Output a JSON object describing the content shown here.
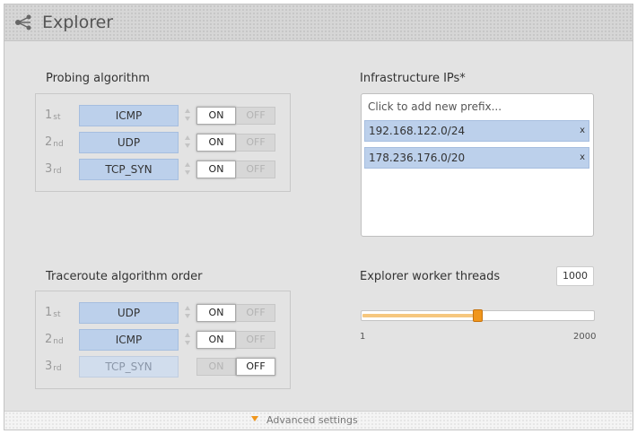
{
  "header": {
    "title": "Explorer",
    "icon": "share-icon"
  },
  "probing": {
    "title": "Probing algorithm",
    "rows": [
      {
        "ordinal": "1",
        "suffix": "st",
        "algo": "ICMP",
        "on": "ON",
        "off": "OFF",
        "state": "on"
      },
      {
        "ordinal": "2",
        "suffix": "nd",
        "algo": "UDP",
        "on": "ON",
        "off": "OFF",
        "state": "on"
      },
      {
        "ordinal": "3",
        "suffix": "rd",
        "algo": "TCP_SYN",
        "on": "ON",
        "off": "OFF",
        "state": "on"
      }
    ]
  },
  "traceroute": {
    "title": "Traceroute algorithm order",
    "rows": [
      {
        "ordinal": "1",
        "suffix": "st",
        "algo": "UDP",
        "on": "ON",
        "off": "OFF",
        "state": "on"
      },
      {
        "ordinal": "2",
        "suffix": "nd",
        "algo": "ICMP",
        "on": "ON",
        "off": "OFF",
        "state": "on"
      },
      {
        "ordinal": "3",
        "suffix": "rd",
        "algo": "TCP_SYN",
        "on": "ON",
        "off": "OFF",
        "state": "off"
      }
    ]
  },
  "infrastructure": {
    "title": "Infrastructure IPs*",
    "placeholder": "Click to add new prefix...",
    "prefixes": [
      "192.168.122.0/24",
      "178.236.176.0/20"
    ],
    "remove_label": "x"
  },
  "threads": {
    "title": "Explorer worker threads",
    "value": "1000",
    "min_label": "1",
    "max_label": "2000",
    "slider_min": 1,
    "slider_max": 2000,
    "slider_value": 1000
  },
  "footer": {
    "advanced_label": "Advanced settings"
  },
  "colors": {
    "accent": "#f0961c",
    "tag_bg": "#bcd0eb",
    "panel_bg": "#e3e3e3"
  }
}
